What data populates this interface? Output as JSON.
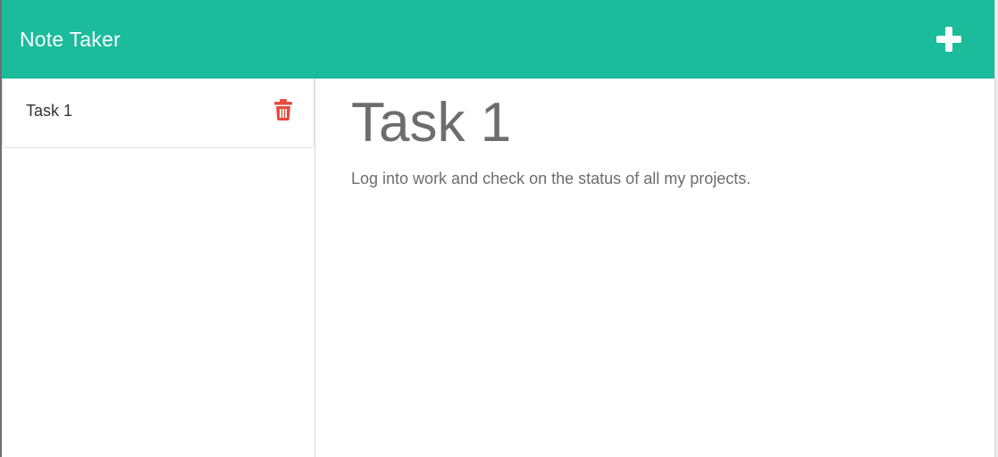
{
  "navbar": {
    "brand": "Note Taker",
    "new_note_icon": "plus-icon",
    "background": "#1abc9c"
  },
  "sidebar": {
    "notes": [
      {
        "title": "Task 1",
        "delete_icon": "trash-icon",
        "delete_color": "#e74c3c"
      }
    ]
  },
  "editor": {
    "title": "Task 1",
    "text": "Log into work and check on the status of all my projects."
  }
}
